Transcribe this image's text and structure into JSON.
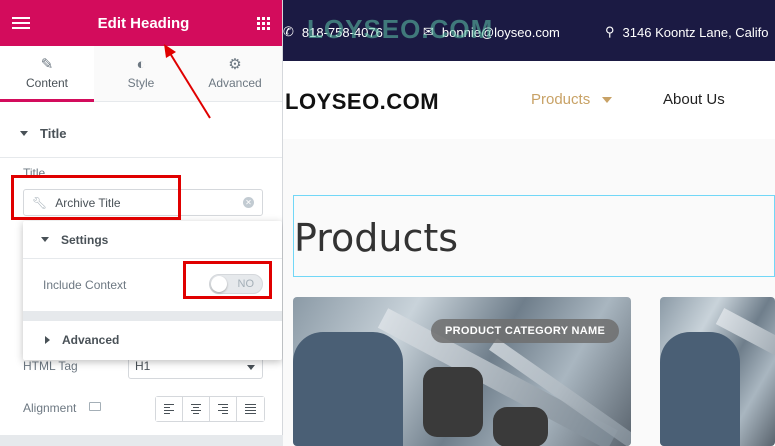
{
  "panel": {
    "title": "Edit Heading",
    "tabs": [
      {
        "label": "Content",
        "icon": "pencil-icon",
        "active": true
      },
      {
        "label": "Style",
        "icon": "contrast-icon",
        "active": false
      },
      {
        "label": "Advanced",
        "icon": "gear-icon",
        "active": false
      }
    ],
    "section_title": "Title",
    "title_field": {
      "label": "Title",
      "value": "Archive Title"
    },
    "settings_popover": {
      "heading": "Settings",
      "include_context_label": "Include Context",
      "include_context_toggle": "NO",
      "advanced_label": "Advanced"
    },
    "html_tag": {
      "label": "HTML Tag",
      "value": "H1"
    },
    "alignment": {
      "label": "Alignment"
    },
    "accent_color": "#d30c5c",
    "annotation_color": "#e00000"
  },
  "site": {
    "topbar": {
      "phone": "818-758-4076",
      "email": "bonnie@loyseo.com",
      "address": "3146 Koontz Lane, Califo",
      "watermark": "LOYSEO.COM"
    },
    "logo": "LOYSEO.COM",
    "nav": [
      {
        "label": "Products",
        "active": true
      },
      {
        "label": "About Us",
        "active": false
      }
    ],
    "page_title": "Products",
    "card_badge": "PRODUCT CATEGORY NAME"
  }
}
